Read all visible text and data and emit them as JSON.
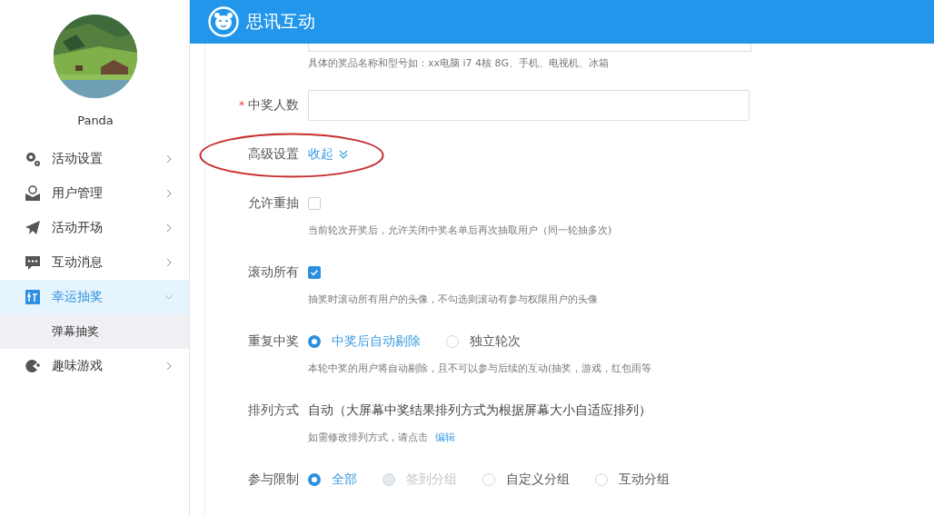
{
  "header": {
    "title": "思讯互动"
  },
  "sidebar": {
    "user": {
      "name": "Panda"
    },
    "menu": [
      {
        "label": "活动设置",
        "selected": false,
        "expanded": false
      },
      {
        "label": "用户管理",
        "selected": false,
        "expanded": false
      },
      {
        "label": "活动开场",
        "selected": false,
        "expanded": false
      },
      {
        "label": "互动消息",
        "selected": false,
        "expanded": false
      },
      {
        "label": "幸运抽奖",
        "selected": true,
        "expanded": true,
        "children": [
          {
            "label": "弹幕抽奖",
            "selected": true
          }
        ]
      },
      {
        "label": "趣味游戏",
        "selected": false,
        "expanded": false
      }
    ]
  },
  "form": {
    "rows": [
      {
        "kind": "input",
        "hint": "具体的奖品名称和型号如：xx电脑 i7 4核 8G、手机、电视机、冰箱"
      },
      {
        "kind": "input",
        "label": "中奖人数",
        "required_mark": "*"
      },
      {
        "kind": "toggle",
        "label": "高级设置",
        "link": "收起",
        "annotated": true
      },
      {
        "kind": "checkbox",
        "label": "允许重抽",
        "checked": false,
        "hint": "当前轮次开奖后，允许关闭中奖名单后再次抽取用户（同一轮抽多次)"
      },
      {
        "kind": "checkbox",
        "label": "滚动所有",
        "checked": true,
        "hint": "抽奖时滚动所有用户的头像，不勾选则滚动有参与权限用户的头像"
      },
      {
        "kind": "radio",
        "label": "重复中奖",
        "options": [
          {
            "label": "中奖后自动剔除",
            "selected": true,
            "disabled": false
          },
          {
            "label": "独立轮次",
            "selected": false,
            "disabled": false
          }
        ],
        "hint": "本轮中奖的用户将自动剔除，且不可以参与后续的互动(抽奖，游戏，红包雨等"
      },
      {
        "kind": "text",
        "label": "排列方式",
        "value": "自动（大屏幕中奖结果排列方式为根据屏幕大小自适应排列）",
        "hint": "如需修改排列方式，请点击",
        "hint_link": "编辑"
      },
      {
        "kind": "radio",
        "label": "参与限制",
        "options": [
          {
            "label": "全部",
            "selected": true,
            "disabled": false
          },
          {
            "label": "签到分组",
            "selected": false,
            "disabled": true
          },
          {
            "label": "自定义分组",
            "selected": false,
            "disabled": false
          },
          {
            "label": "互动分组",
            "selected": false,
            "disabled": false
          }
        ]
      }
    ]
  }
}
